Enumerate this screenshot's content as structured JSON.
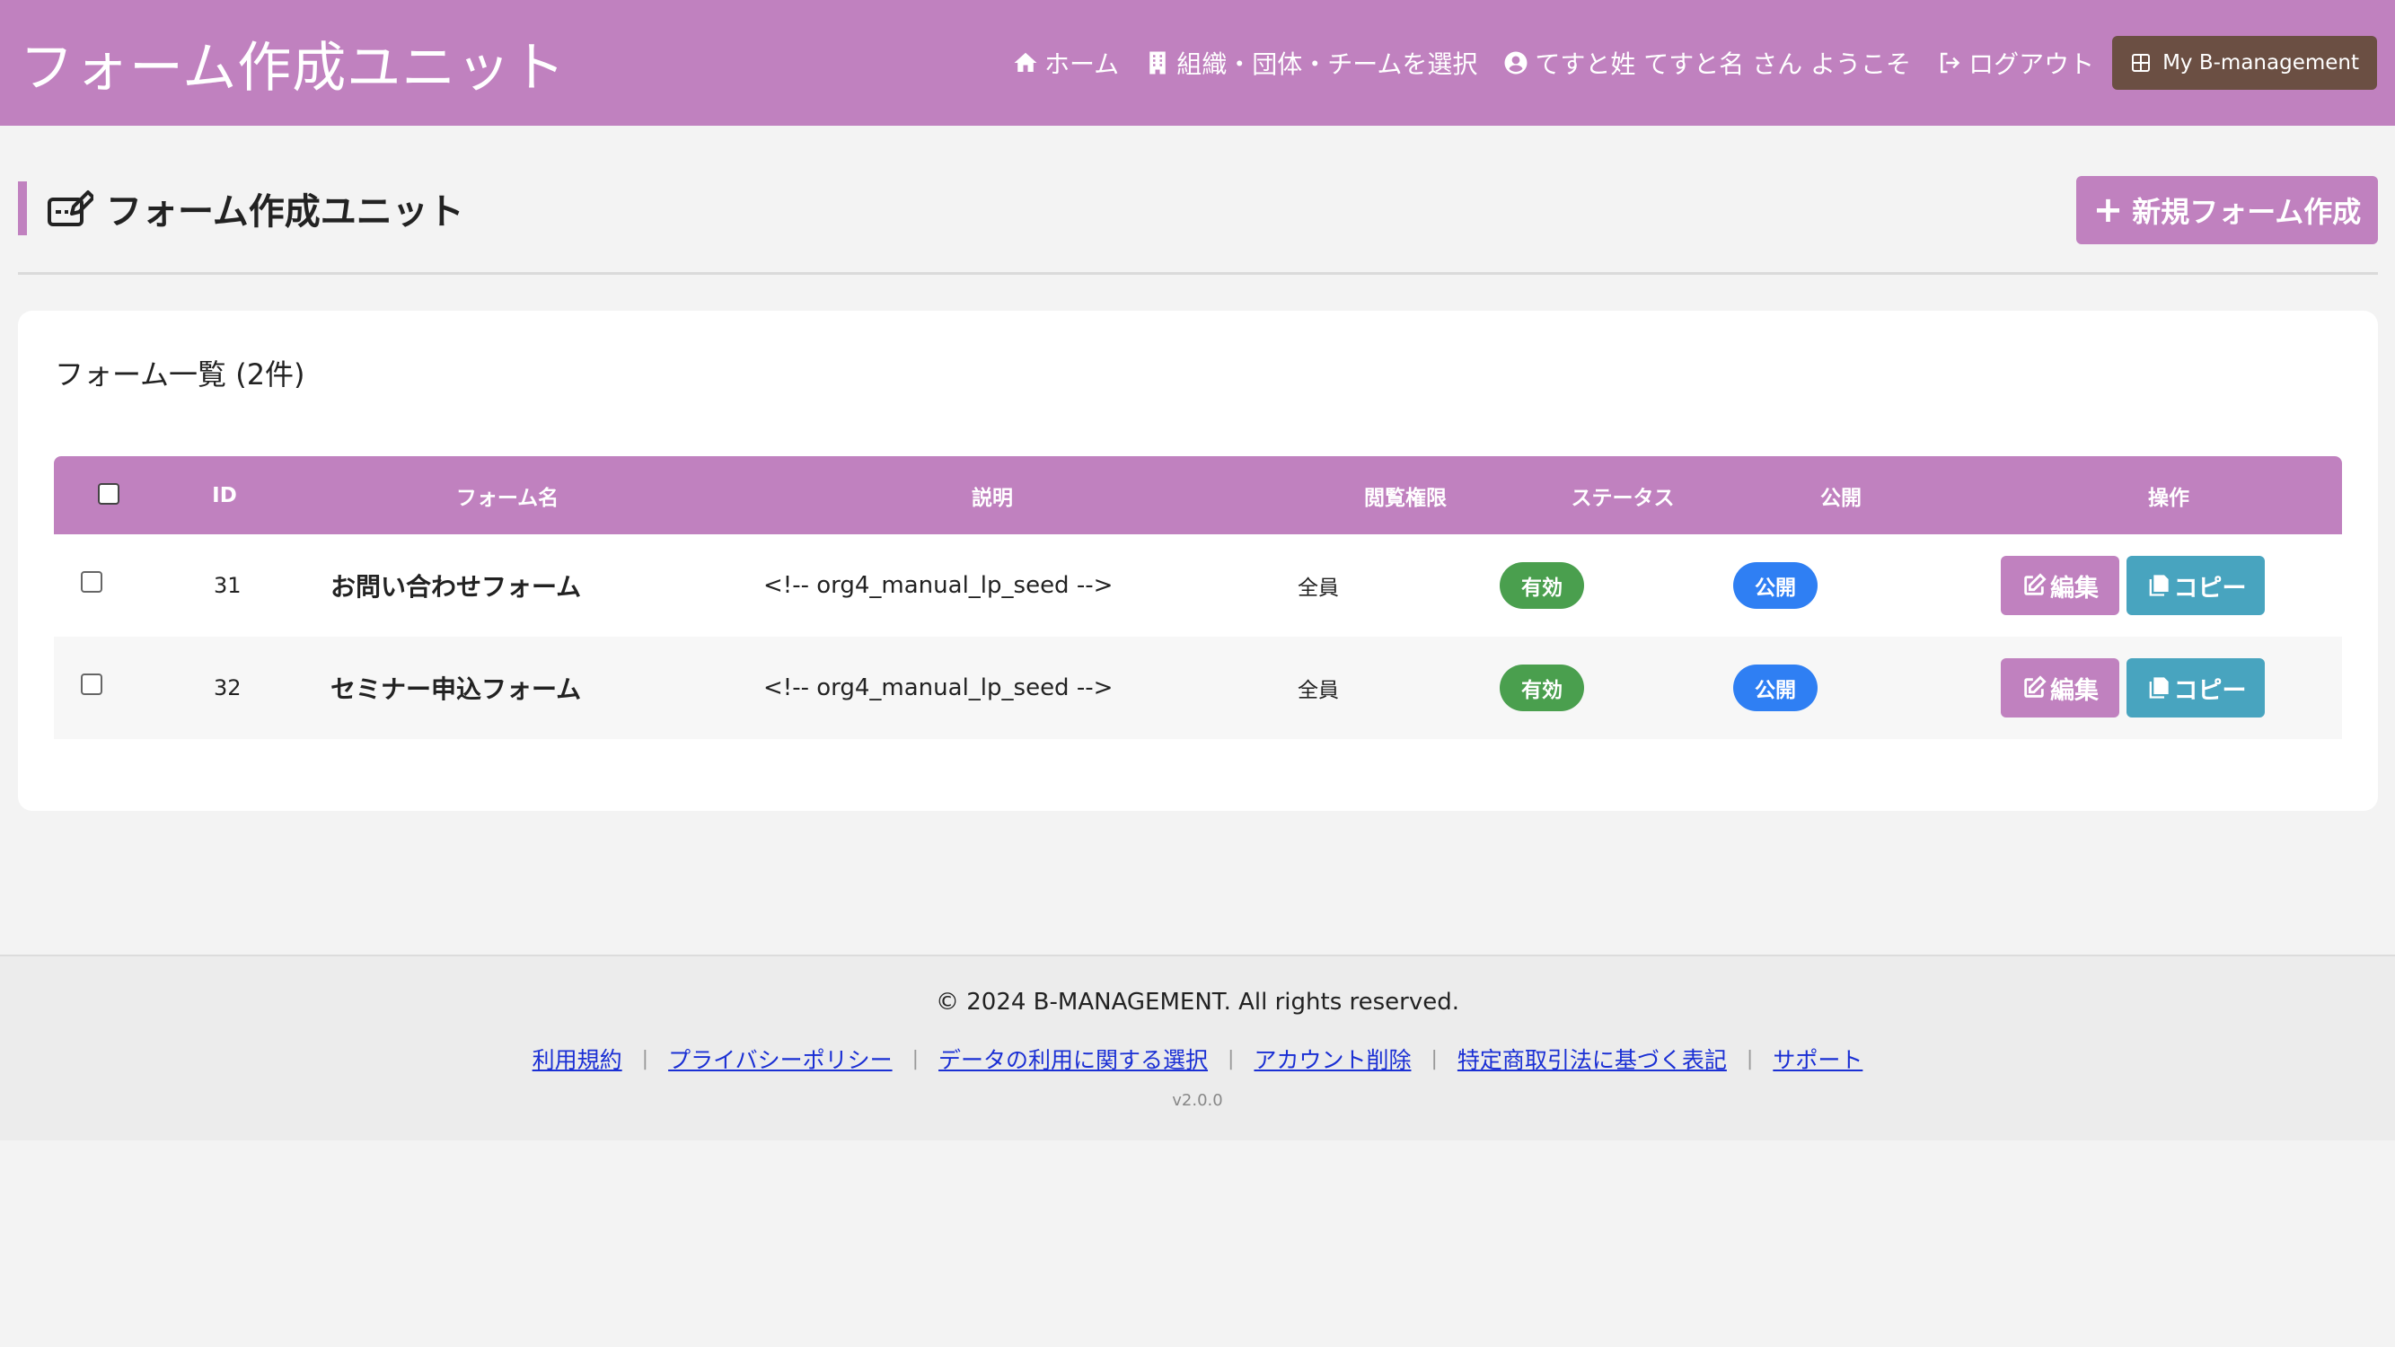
{
  "header": {
    "brand": "フォーム作成ユニット",
    "nav": {
      "home": "ホーム",
      "org_select": "組織・団体・チームを選択",
      "welcome": "てすと姓 てすと名 さん ようこそ",
      "logout": "ログアウト",
      "my_bm": "My B-management"
    }
  },
  "page": {
    "title": "フォーム作成ユニット",
    "new_button": "新規フォーム作成"
  },
  "list": {
    "title": "フォーム一覧 (2件)",
    "columns": [
      "ID",
      "フォーム名",
      "説明",
      "閲覧権限",
      "ステータス",
      "公開",
      "操作"
    ],
    "rows": [
      {
        "id": "31",
        "name": "お問い合わせフォーム",
        "description": "<!-- org4_manual_lp_seed -->",
        "permission": "全員",
        "status": "有効",
        "public": "公開",
        "edit": "編集",
        "copy": "コピー"
      },
      {
        "id": "32",
        "name": "セミナー申込フォーム",
        "description": "<!-- org4_manual_lp_seed -->",
        "permission": "全員",
        "status": "有効",
        "public": "公開",
        "edit": "編集",
        "copy": "コピー"
      }
    ]
  },
  "footer": {
    "copyright": "© 2024 B-MANAGEMENT. All rights reserved.",
    "links": [
      "利用規約",
      "プライバシーポリシー",
      "データの利用に関する選択",
      "アカウント削除",
      "特定商取引法に基づく表記",
      "サポート"
    ],
    "separator": "|",
    "version": "v2.0.0"
  },
  "colors": {
    "accent": "#c081bf",
    "status_active": "#4a9f4e",
    "public_badge": "#2f7ff3",
    "copy_button": "#48a4bf",
    "my_bm_button": "#6b4f43"
  }
}
